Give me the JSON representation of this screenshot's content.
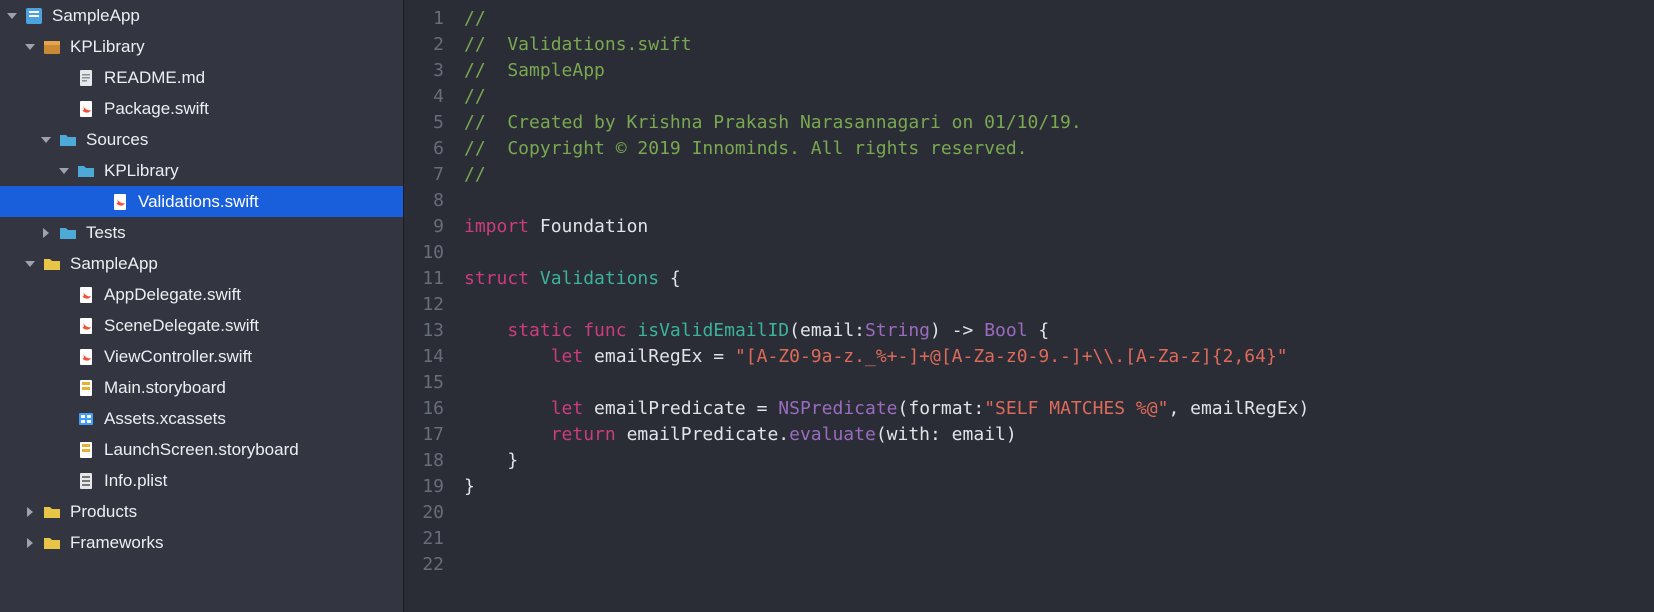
{
  "sidebar": {
    "items": [
      {
        "label": "SampleApp",
        "indent": 6,
        "disclosure": "down",
        "icon": "xcodeproj"
      },
      {
        "label": "KPLibrary",
        "indent": 24,
        "disclosure": "down",
        "icon": "package"
      },
      {
        "label": "README.md",
        "indent": 58,
        "disclosure": "none",
        "icon": "doc"
      },
      {
        "label": "Package.swift",
        "indent": 58,
        "disclosure": "none",
        "icon": "swift"
      },
      {
        "label": "Sources",
        "indent": 40,
        "disclosure": "down",
        "icon": "folder-sky"
      },
      {
        "label": "KPLibrary",
        "indent": 58,
        "disclosure": "down",
        "icon": "folder-sky"
      },
      {
        "label": "Validations.swift",
        "indent": 92,
        "disclosure": "none",
        "icon": "swift",
        "selected": true
      },
      {
        "label": "Tests",
        "indent": 40,
        "disclosure": "right",
        "icon": "folder-sky"
      },
      {
        "label": "SampleApp",
        "indent": 24,
        "disclosure": "down",
        "icon": "folder-yellow"
      },
      {
        "label": "AppDelegate.swift",
        "indent": 58,
        "disclosure": "none",
        "icon": "swift"
      },
      {
        "label": "SceneDelegate.swift",
        "indent": 58,
        "disclosure": "none",
        "icon": "swift"
      },
      {
        "label": "ViewController.swift",
        "indent": 58,
        "disclosure": "none",
        "icon": "swift"
      },
      {
        "label": "Main.storyboard",
        "indent": 58,
        "disclosure": "none",
        "icon": "storyboard"
      },
      {
        "label": "Assets.xcassets",
        "indent": 58,
        "disclosure": "none",
        "icon": "assets"
      },
      {
        "label": "LaunchScreen.storyboard",
        "indent": 58,
        "disclosure": "none",
        "icon": "storyboard"
      },
      {
        "label": "Info.plist",
        "indent": 58,
        "disclosure": "none",
        "icon": "plist"
      },
      {
        "label": "Products",
        "indent": 24,
        "disclosure": "right",
        "icon": "folder-yellow"
      },
      {
        "label": "Frameworks",
        "indent": 24,
        "disclosure": "right",
        "icon": "folder-yellow"
      }
    ]
  },
  "code": {
    "lines": [
      {
        "n": 1,
        "t": [
          {
            "c": "c-comment",
            "s": "//"
          }
        ]
      },
      {
        "n": 2,
        "t": [
          {
            "c": "c-comment",
            "s": "//  Validations.swift"
          }
        ]
      },
      {
        "n": 3,
        "t": [
          {
            "c": "c-comment",
            "s": "//  SampleApp"
          }
        ]
      },
      {
        "n": 4,
        "t": [
          {
            "c": "c-comment",
            "s": "//"
          }
        ]
      },
      {
        "n": 5,
        "t": [
          {
            "c": "c-comment",
            "s": "//  Created by Krishna Prakash Narasannagari on 01/10/19."
          }
        ]
      },
      {
        "n": 6,
        "t": [
          {
            "c": "c-comment",
            "s": "//  Copyright © 2019 Innominds. All rights reserved."
          }
        ]
      },
      {
        "n": 7,
        "t": [
          {
            "c": "c-comment",
            "s": "//"
          }
        ]
      },
      {
        "n": 8,
        "t": [
          {
            "c": "",
            "s": ""
          }
        ]
      },
      {
        "n": 9,
        "t": [
          {
            "c": "c-keyword",
            "s": "import"
          },
          {
            "c": "",
            "s": " Foundation"
          }
        ]
      },
      {
        "n": 10,
        "t": [
          {
            "c": "",
            "s": ""
          }
        ]
      },
      {
        "n": 11,
        "t": [
          {
            "c": "c-keyword",
            "s": "struct"
          },
          {
            "c": "",
            "s": " "
          },
          {
            "c": "c-deftype",
            "s": "Validations"
          },
          {
            "c": "",
            "s": " {"
          }
        ]
      },
      {
        "n": 12,
        "t": [
          {
            "c": "",
            "s": "    "
          }
        ]
      },
      {
        "n": 13,
        "t": [
          {
            "c": "",
            "s": "    "
          },
          {
            "c": "c-keyword",
            "s": "static func"
          },
          {
            "c": "",
            "s": " "
          },
          {
            "c": "c-func",
            "s": "isValidEmailID"
          },
          {
            "c": "",
            "s": "(email:"
          },
          {
            "c": "c-type",
            "s": "String"
          },
          {
            "c": "",
            "s": ") -> "
          },
          {
            "c": "c-type",
            "s": "Bool"
          },
          {
            "c": "",
            "s": " {"
          }
        ]
      },
      {
        "n": 14,
        "t": [
          {
            "c": "",
            "s": "        "
          },
          {
            "c": "c-keyword",
            "s": "let"
          },
          {
            "c": "",
            "s": " emailRegEx = "
          },
          {
            "c": "c-string",
            "s": "\"[A-Z0-9a-z._%+-]+@[A-Za-z0-9.-]+\\\\.[A-Za-z]{2,64}\""
          }
        ]
      },
      {
        "n": 15,
        "t": [
          {
            "c": "",
            "s": ""
          }
        ]
      },
      {
        "n": 16,
        "t": [
          {
            "c": "",
            "s": "        "
          },
          {
            "c": "c-keyword",
            "s": "let"
          },
          {
            "c": "",
            "s": " emailPredicate = "
          },
          {
            "c": "c-type",
            "s": "NSPredicate"
          },
          {
            "c": "",
            "s": "(format:"
          },
          {
            "c": "c-string",
            "s": "\"SELF MATCHES %@\""
          },
          {
            "c": "",
            "s": ", emailRegEx)"
          }
        ]
      },
      {
        "n": 17,
        "t": [
          {
            "c": "",
            "s": "        "
          },
          {
            "c": "c-keyword",
            "s": "return"
          },
          {
            "c": "",
            "s": " emailPredicate."
          },
          {
            "c": "c-call",
            "s": "evaluate"
          },
          {
            "c": "",
            "s": "(with: email)"
          }
        ]
      },
      {
        "n": 18,
        "t": [
          {
            "c": "",
            "s": "    }"
          }
        ]
      },
      {
        "n": 19,
        "t": [
          {
            "c": "",
            "s": "}"
          }
        ]
      },
      {
        "n": 20,
        "t": [
          {
            "c": "",
            "s": ""
          }
        ]
      },
      {
        "n": 21,
        "t": [
          {
            "c": "",
            "s": ""
          }
        ]
      },
      {
        "n": 22,
        "t": [
          {
            "c": "",
            "s": ""
          }
        ]
      }
    ]
  }
}
